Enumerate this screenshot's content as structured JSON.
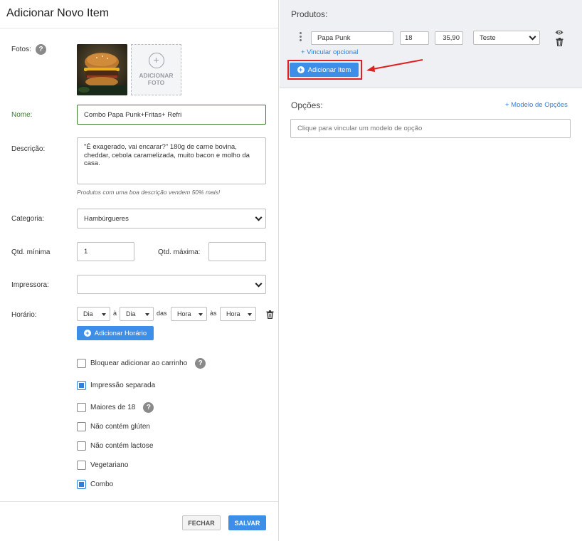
{
  "left": {
    "title": "Adicionar Novo Item",
    "photos": {
      "label": "Fotos:",
      "add_label_1": "ADICIONAR",
      "add_label_2": "FOTO"
    },
    "name": {
      "label": "Nome:",
      "value": "Combo Papa Punk+Fritas+ Refri"
    },
    "description": {
      "label": "Descrição:",
      "value": "\"É exagerado, vai encarar?\" 180g de carne bovina, cheddar, cebola caramelizada, muito bacon e molho da casa.",
      "hint": "Produtos com uma boa descrição vendem 50% mais!"
    },
    "category": {
      "label": "Categoria:",
      "value": "Hambúrgueres"
    },
    "qty_min": {
      "label": "Qtd. mínima",
      "value": "1"
    },
    "qty_max": {
      "label": "Qtd. máxima:",
      "value": ""
    },
    "printer": {
      "label": "Impressora:",
      "value": ""
    },
    "schedule": {
      "label": "Horário:",
      "day_from": "Dia",
      "sep1": "à",
      "day_to": "Dia",
      "sep2": "das",
      "hour_from": "Hora",
      "sep3": "às",
      "hour_to": "Hora",
      "add_label": "Adicionar Horário"
    },
    "checkboxes": [
      {
        "label": "Bloquear adicionar ao carrinho",
        "checked": false,
        "help": true
      },
      {
        "label": "Impressão separada",
        "checked": true,
        "help": false
      },
      {
        "label": "Maiores de 18",
        "checked": false,
        "help": true
      },
      {
        "label": "Não contém glúten",
        "checked": false,
        "help": false
      },
      {
        "label": "Não contém lactose",
        "checked": false,
        "help": false
      },
      {
        "label": "Vegetariano",
        "checked": false,
        "help": false
      },
      {
        "label": "Combo",
        "checked": true,
        "help": false
      }
    ],
    "help_glyph": "?",
    "footer": {
      "close_label": "FECHAR",
      "save_label": "SALVAR"
    }
  },
  "right": {
    "products": {
      "title": "Produtos:",
      "row": {
        "name": "Papa Punk",
        "qty": "18",
        "price": "35,90",
        "select": "Teste"
      },
      "link_optional": "+ Vincular opcional",
      "add_item_label": "Adicionar Item"
    },
    "options": {
      "title": "Opções:",
      "model_link": "+ Modelo de Opções",
      "placeholder": "Clique para vincular um modelo de opção"
    }
  },
  "colors": {
    "accent": "#3d8ee8",
    "highlight": "#e02020",
    "name_label": "#3c7a2c"
  }
}
